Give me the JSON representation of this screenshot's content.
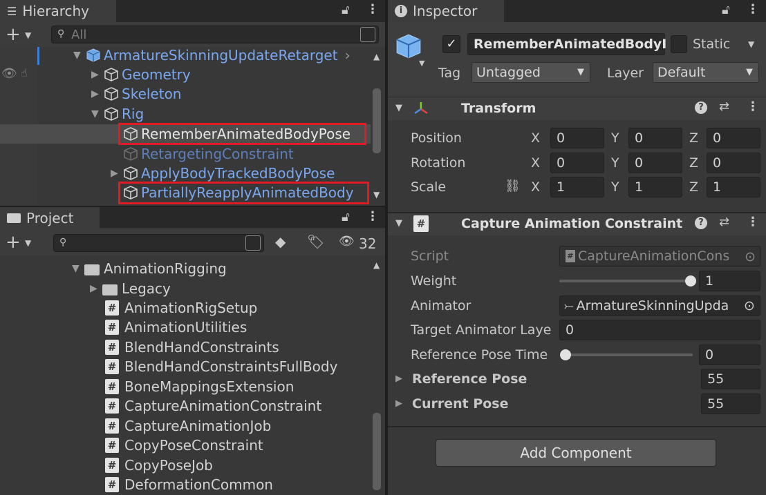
{
  "hierarchy": {
    "tab_label": "Hierarchy",
    "search_placeholder": "All",
    "rows": [
      {
        "label": "ArmatureSkinningUpdateRetarget",
        "style": "blue",
        "expanded": true
      },
      {
        "label": "Geometry",
        "style": "blue",
        "expanded": false
      },
      {
        "label": "Skeleton",
        "style": "blue",
        "expanded": false
      },
      {
        "label": "Rig",
        "style": "blue",
        "expanded": true
      },
      {
        "label": "RememberAnimatedBodyPose",
        "style": "white",
        "selected": true,
        "highlighted": true
      },
      {
        "label": "RetargetingConstraint",
        "style": "dimblue"
      },
      {
        "label": "ApplyBodyTrackedBodyPose",
        "style": "blue",
        "expanded": false
      },
      {
        "label": "PartiallyReapplyAnimatedBody",
        "style": "blue",
        "highlighted": true
      }
    ]
  },
  "project": {
    "tab_label": "Project",
    "hidden_count": "32",
    "folders": [
      {
        "label": "AnimationRigging",
        "expanded": true
      },
      {
        "label": "Legacy",
        "expanded": false
      }
    ],
    "scripts": [
      "AnimationRigSetup",
      "AnimationUtilities",
      "BlendHandConstraints",
      "BlendHandConstraintsFullBody",
      "BoneMappingsExtension",
      "CaptureAnimationConstraint",
      "CaptureAnimationJob",
      "CopyPoseConstraint",
      "CopyPoseJob",
      "DeformationCommon"
    ]
  },
  "inspector": {
    "tab_label": "Inspector",
    "object_name": "RememberAnimatedBodyI",
    "static_label": "Static",
    "tag_label": "Tag",
    "tag_value": "Untagged",
    "layer_label": "Layer",
    "layer_value": "Default",
    "transform": {
      "title": "Transform",
      "rows": [
        {
          "label": "Position",
          "x": "0",
          "y": "0",
          "z": "0"
        },
        {
          "label": "Rotation",
          "x": "0",
          "y": "0",
          "z": "0"
        },
        {
          "label": "Scale",
          "x": "1",
          "y": "1",
          "z": "1"
        }
      ],
      "axis_x": "X",
      "axis_y": "Y",
      "axis_z": "Z"
    },
    "capture": {
      "title": "Capture Animation Constraint",
      "script_label": "Script",
      "script_value": "CaptureAnimationCons",
      "weight_label": "Weight",
      "weight_value": "1",
      "weight_fraction": 1.0,
      "animator_label": "Animator",
      "animator_value": "ArmatureSkinningUpda",
      "target_layer_label": "Target Animator Laye",
      "target_layer_value": "0",
      "ref_time_label": "Reference Pose Time",
      "ref_time_value": "0",
      "ref_time_fraction": 0.0,
      "ref_pose_label": "Reference Pose",
      "ref_pose_value": "55",
      "cur_pose_label": "Current Pose",
      "cur_pose_value": "55"
    },
    "add_component_label": "Add Component"
  },
  "colors": {
    "highlight_red": "#e01b24",
    "link_blue": "#7aa8f0",
    "selected_row": "#4d4d4d"
  }
}
